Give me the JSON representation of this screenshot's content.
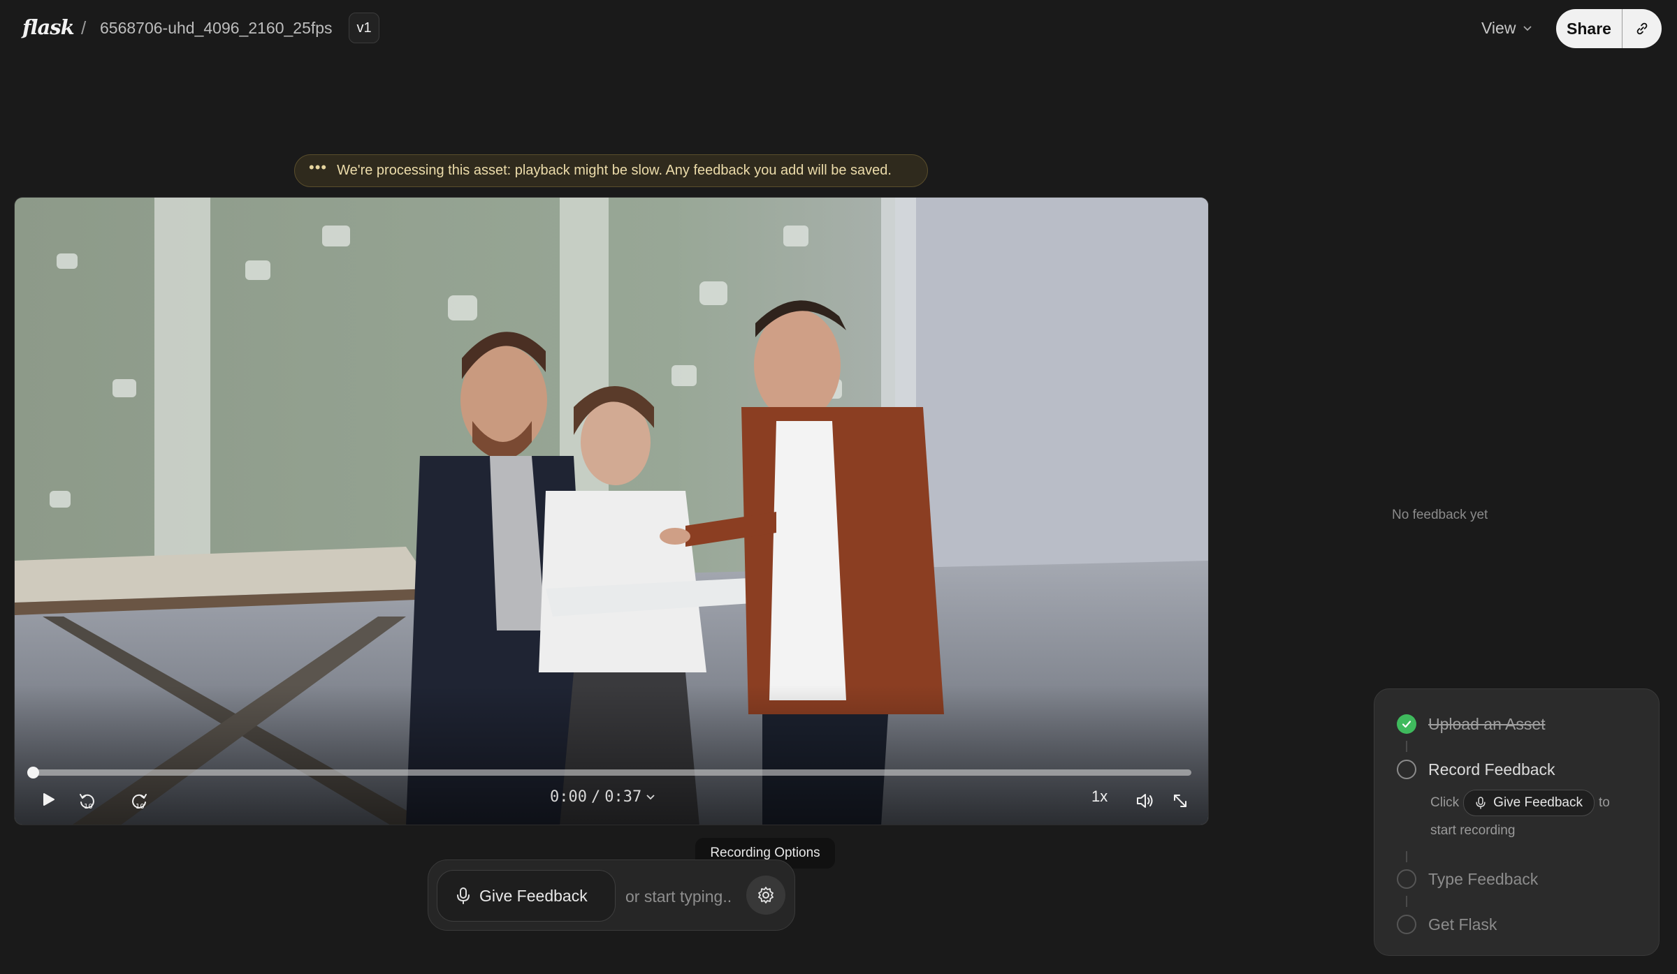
{
  "header": {
    "logo": "flask",
    "separator": "/",
    "file_name": "6568706-uhd_4096_2160_25fps",
    "version": "v1",
    "view_label": "View",
    "share_label": "Share",
    "link_icon": "link-icon"
  },
  "banner": {
    "dots": "•••",
    "text": "We're processing this asset: playback might be slow. Any feedback you add will be saved."
  },
  "player": {
    "progress": 0,
    "time_current": "0:00",
    "time_separator": "/",
    "time_total": "0:37",
    "speed": "1x",
    "icons": [
      "play-icon",
      "rewind-10-icon",
      "forward-10-icon",
      "volume-icon",
      "fullscreen-icon"
    ]
  },
  "feedback": {
    "tooltip": "Recording Options",
    "give_label": "Give Feedback",
    "input_placeholder": "or start typing..",
    "empty_state": "No feedback yet"
  },
  "onboarding": {
    "steps": [
      {
        "label": "Upload an Asset",
        "status": "done"
      },
      {
        "label": "Record Feedback",
        "status": "active"
      },
      {
        "label": "Type Feedback",
        "status": "todo"
      },
      {
        "label": "Get Flask",
        "status": "todo"
      }
    ],
    "hint_prefix": "Click",
    "hint_chip": "Give Feedback",
    "hint_suffix": "to",
    "hint_line2": "start recording"
  },
  "colors": {
    "background": "#1a1a1a",
    "banner_bg": "#2f2a1d",
    "banner_text": "#ecdcaa",
    "success": "#3fba5d"
  }
}
